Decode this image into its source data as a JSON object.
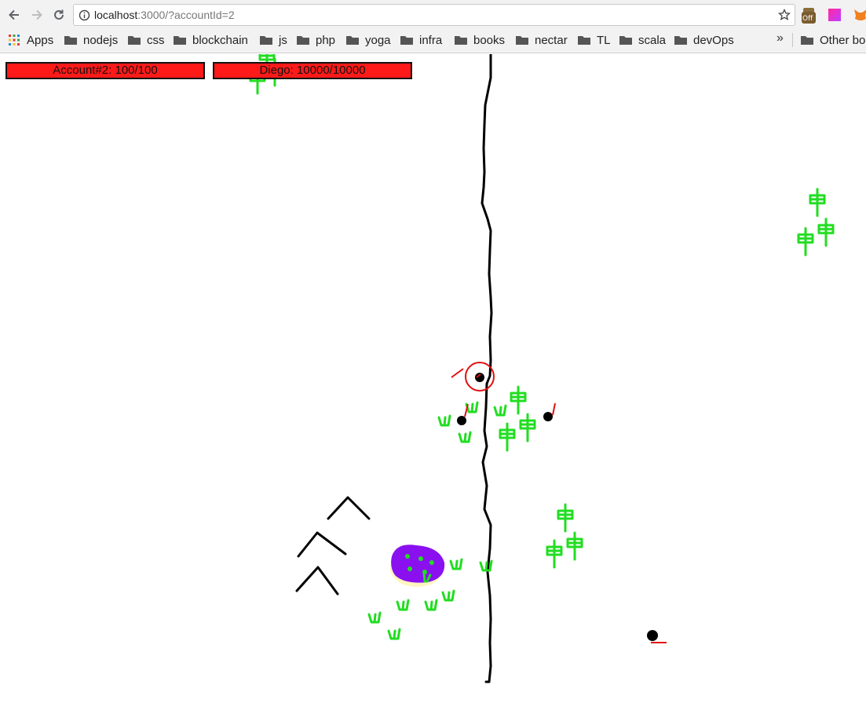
{
  "browser": {
    "url_host": "localhost",
    "url_path": ":3000/?accountId=2",
    "bookmarks": [
      "Apps",
      "nodejs",
      "css",
      "blockchain",
      "js",
      "php",
      "yoga",
      "infra",
      "books",
      "nectar",
      "TL",
      "scala",
      "devOps"
    ],
    "overflow": "»",
    "other_bookmarks": "Other bo",
    "extension_badge": "Off"
  },
  "hud": {
    "player_bar": "Account#2: 100/100",
    "target_bar": "Diego: 10000/10000",
    "bar_color": "#ff1a1a"
  },
  "colors": {
    "tree": "#22dd22",
    "river": "#000000",
    "lake": "#8a10f0",
    "selection_ring": "#e01010",
    "character": "#000000"
  }
}
